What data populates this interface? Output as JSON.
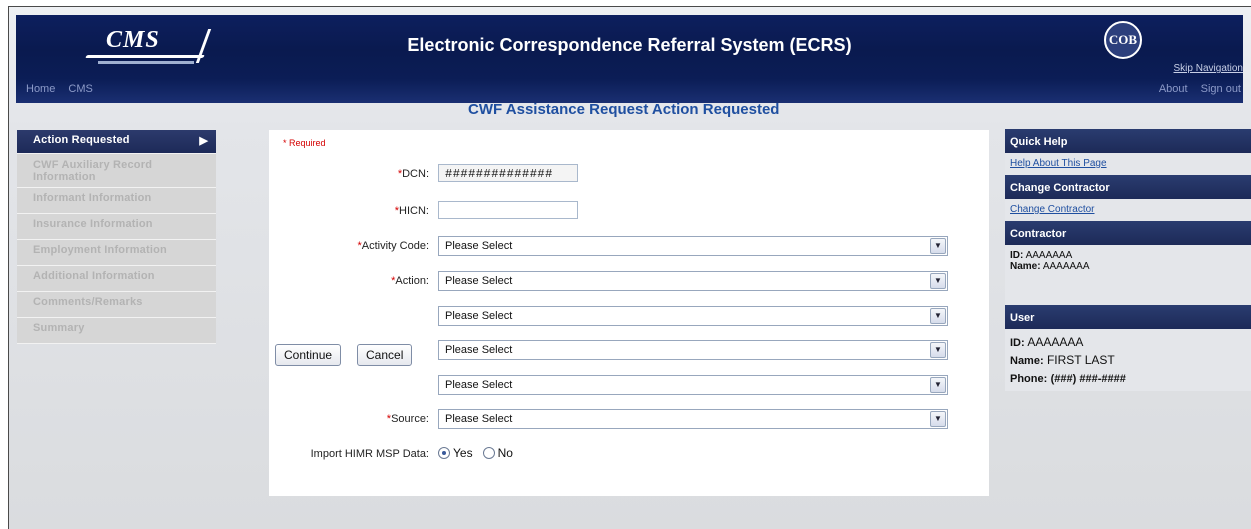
{
  "header": {
    "logo_text": "CMS",
    "title": "Electronic Correspondence Referral System (ECRS)",
    "cob_logo_text": "COB",
    "skip_link": "Skip Navigation"
  },
  "navbar": {
    "left": [
      "Home",
      "CMS"
    ],
    "right": [
      "About",
      "Sign out"
    ]
  },
  "page_title": "CWF Assistance Request Action Requested",
  "left_nav": {
    "items": [
      {
        "label": "Action Requested",
        "active": true
      },
      {
        "label": "CWF Auxiliary Record Information"
      },
      {
        "label": "Informant Information"
      },
      {
        "label": "Insurance Information"
      },
      {
        "label": "Employment Information"
      },
      {
        "label": "Additional Information"
      },
      {
        "label": "Comments/Remarks"
      },
      {
        "label": "Summary"
      }
    ]
  },
  "form": {
    "required_note": "* Required",
    "dcn": {
      "label": "DCN:",
      "value": "##############"
    },
    "hicn": {
      "label": "HICN:",
      "value": ""
    },
    "activity_code": {
      "label": "Activity Code:",
      "value": "Please Select"
    },
    "action": {
      "label": "Action:",
      "values": [
        "Please Select",
        "Please Select",
        "Please Select",
        "Please Select"
      ]
    },
    "source": {
      "label": "Source:",
      "value": "Please Select"
    },
    "import": {
      "label": "Import HIMR MSP Data:",
      "yes": "Yes",
      "no": "No",
      "selected": "Yes"
    },
    "continue_label": "Continue",
    "cancel_label": "Cancel"
  },
  "right_panel": {
    "quick_help": {
      "title": "Quick Help",
      "link": "Help About This Page"
    },
    "change_contractor": {
      "title": "Change Contractor",
      "link": "Change Contractor"
    },
    "contractor": {
      "title": "Contractor",
      "id_label": "ID:",
      "id": "AAAAAAA",
      "name_label": "Name:",
      "name": "AAAAAAA"
    },
    "user": {
      "title": "User",
      "id_label": "ID:",
      "id": "AAAAAAA",
      "name_label": "Name:",
      "name": "FIRST LAST",
      "phone_label": "Phone:",
      "phone": "(###) ###-####"
    }
  },
  "colors": {
    "banner": "#0d1f5e",
    "accent_blue": "#1f4fa0",
    "required_red": "#d40000"
  }
}
